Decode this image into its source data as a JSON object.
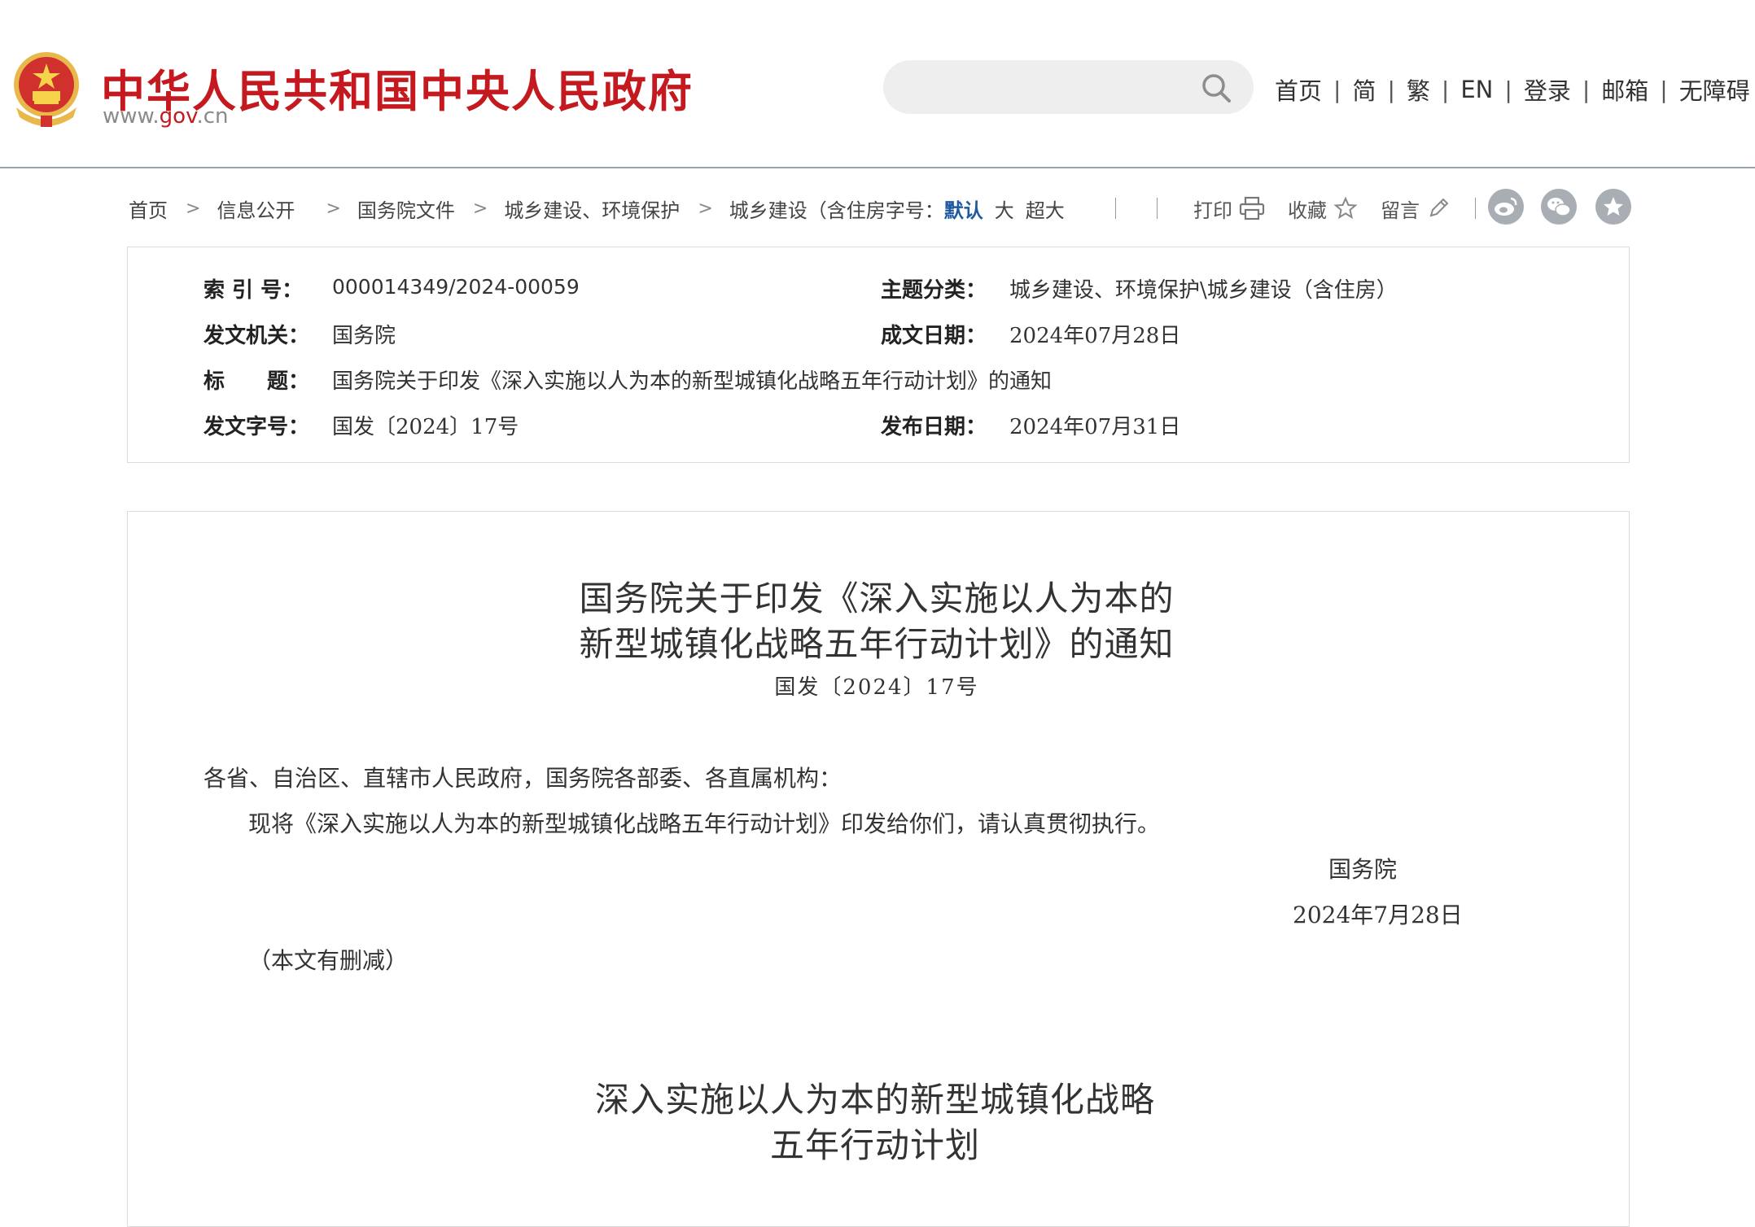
{
  "header": {
    "site_name": "中华人民共和国中央人民政府",
    "url_prefix": "www.",
    "url_highlight": "gov",
    "url_suffix": ".cn",
    "search": {
      "placeholder": ""
    },
    "nav": [
      "首页",
      "简",
      "繁",
      "EN",
      "登录",
      "邮箱",
      "无障碍"
    ]
  },
  "breadcrumb": {
    "items": [
      "首页",
      "信息公开",
      "国务院文件",
      "城乡建设、环境保护",
      "城乡建设（含住房"
    ],
    "font_size_label": "字号：",
    "font_sizes": [
      "默认",
      "大",
      "超大"
    ]
  },
  "tools": {
    "print": "打印",
    "favorite": "收藏",
    "comment": "留言"
  },
  "share": [
    "weibo-share",
    "wechat-share",
    "favorite-share"
  ],
  "info": {
    "index_label": "索 引 号：",
    "index_value": "000014349/2024-00059",
    "topic_label": "主题分类：",
    "topic_value": "城乡建设、环境保护\\城乡建设（含住房）",
    "issuer_label": "发文机关：",
    "issuer_value": "国务院",
    "written_date_label": "成文日期：",
    "written_date_value": "2024年07月28日",
    "title_label": "标　　题：",
    "title_value": "国务院关于印发《深入实施以人为本的新型城镇化战略五年行动计划》的通知",
    "doc_no_label": "发文字号：",
    "doc_no_value": "国发〔2024〕17号",
    "publish_date_label": "发布日期：",
    "publish_date_value": "2024年07月31日"
  },
  "article": {
    "title_line1": "国务院关于印发《深入实施以人为本的",
    "title_line2": "新型城镇化战略五年行动计划》的通知",
    "doc_number": "国发〔2024〕17号",
    "salutation": "各省、自治区、直辖市人民政府，国务院各部委、各直属机构：",
    "body": "现将《深入实施以人为本的新型城镇化战略五年行动计划》印发给你们，请认真贯彻执行。",
    "signature": "国务院",
    "signature_date": "2024年7月28日",
    "note": "（本文有删减）",
    "plan_title_line1": "深入实施以人为本的新型城镇化战略",
    "plan_title_line2": "五年行动计划"
  },
  "colors": {
    "brand_red": "#c4191f",
    "link_blue": "#1f5a9e",
    "icon_gray": "#a9aeb4"
  }
}
